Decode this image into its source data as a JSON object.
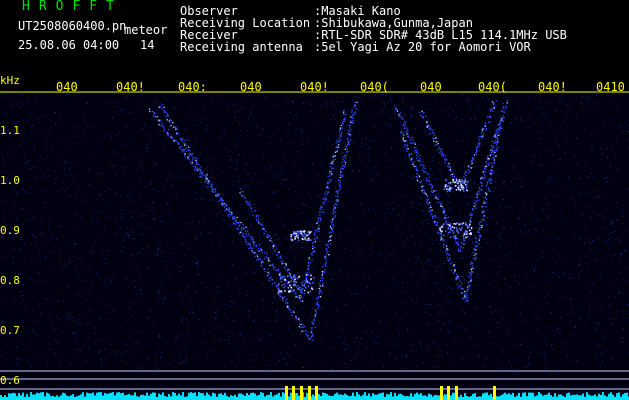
{
  "header": {
    "app_title": "HROFFT",
    "file_name": "UT2508060400.pn",
    "meteor_label": "meteor",
    "timestamp": "25.08.06 04:00",
    "meteor_count": "14"
  },
  "info": [
    {
      "label": "Observer",
      "value": ":Masaki Kano"
    },
    {
      "label": "Receiving Location",
      "value": ":Shibukawa,Gunma,Japan"
    },
    {
      "label": "Receiver",
      "value": ":RTL-SDR SDR# 43dB L15 114.1MHz USB"
    },
    {
      "label": "Receiving antenna",
      "value": ":5el Yagi Az 20 for Aomori VOR"
    }
  ],
  "x_axis": {
    "ticks": [
      "040",
      "040!",
      "040:",
      "040",
      "040!",
      "040(",
      "040",
      "040(",
      "040!",
      "0410"
    ]
  },
  "y_axis": {
    "unit": "kHz",
    "ticks": [
      "1.1",
      "1.0",
      "0.9",
      "0.8",
      "0.7",
      "0.6"
    ]
  },
  "colors": {
    "background": "#000000",
    "title_green": "#00e000",
    "tick_yellow": "#ffff00",
    "signal_blue": "#2a4bff",
    "signal_cyan": "#00e0ff"
  }
}
